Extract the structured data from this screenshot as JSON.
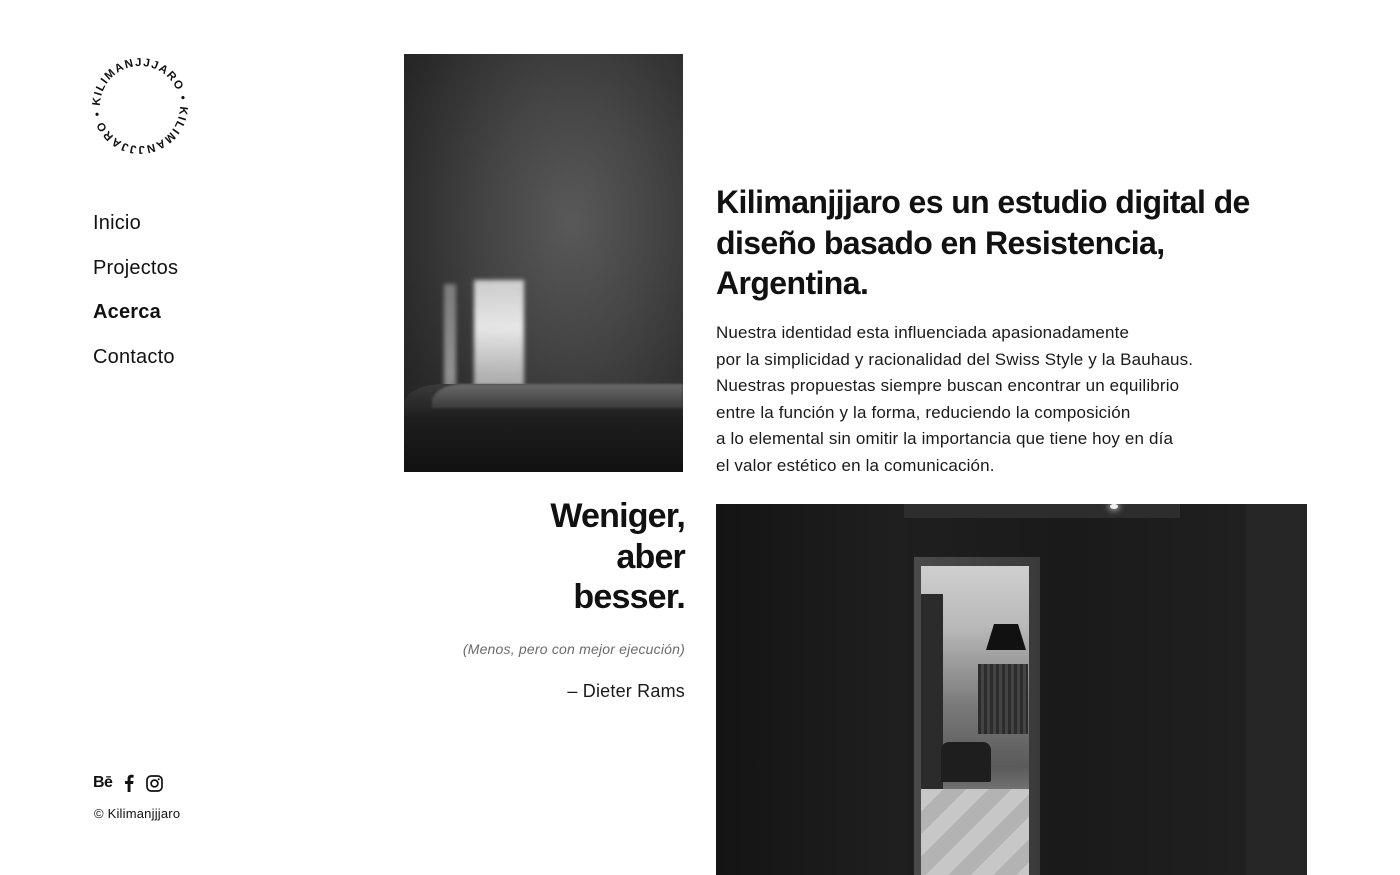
{
  "brand": {
    "logo_text": "KILIMANJJJARO • KILIMANJJJARO •"
  },
  "nav": {
    "items": [
      {
        "label": "Inicio",
        "active": false
      },
      {
        "label": "Projectos",
        "active": false
      },
      {
        "label": "Acerca",
        "active": true
      },
      {
        "label": "Contacto",
        "active": false
      }
    ]
  },
  "social": {
    "behance_label": "Bē",
    "icons": [
      "behance-icon",
      "facebook-icon",
      "instagram-icon"
    ]
  },
  "footer": {
    "copyright": "© Kilimanjjjaro"
  },
  "about": {
    "headline": "Kilimanjjjaro es un estudio digital de diseño basado en Resistencia, Argentina.",
    "body_lines": [
      "Nuestra identidad esta influenciada apasionadamente",
      "por la simplicidad y racionalidad del Swiss Style y la Bauhaus.",
      "Nuestras propuestas siempre buscan encontrar un equilibrio",
      "entre la función y la forma, reduciendo la composición",
      "a lo elemental sin omitir la importancia que tiene hoy en día",
      "el valor estético en la comunicación."
    ]
  },
  "quote": {
    "lines": [
      "Weniger,",
      "aber",
      "besser."
    ],
    "translation": "(Menos, pero con mejor ejecución)",
    "author": "– Dieter Rams"
  },
  "colors": {
    "text": "#111111",
    "muted": "#6b6b6b",
    "background": "#ffffff"
  }
}
